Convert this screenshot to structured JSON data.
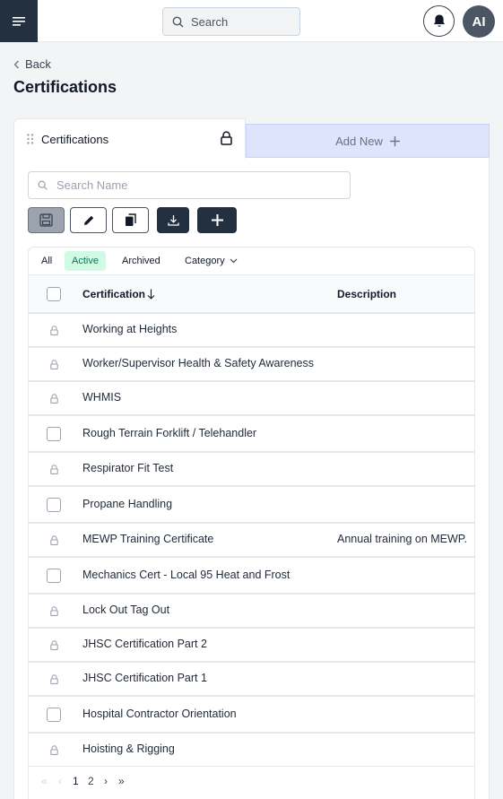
{
  "header": {
    "search_placeholder": "Search",
    "avatar_initials": "AI"
  },
  "nav": {
    "back_label": "Back",
    "page_title": "Certifications"
  },
  "tabs": {
    "active_label": "Certifications",
    "add_label": "Add New"
  },
  "search": {
    "placeholder": "Search Name"
  },
  "filters": {
    "all": "All",
    "active": "Active",
    "archived": "Archived",
    "category": "Category"
  },
  "table": {
    "col_certification": "Certification",
    "col_description": "Description",
    "rows": [
      {
        "name": "Working at Heights",
        "description": "",
        "locked": true
      },
      {
        "name": "Worker/Supervisor Health & Safety Awareness",
        "description": "",
        "locked": true
      },
      {
        "name": "WHMIS",
        "description": "",
        "locked": true
      },
      {
        "name": "Rough Terrain Forklift / Telehandler",
        "description": "",
        "locked": false
      },
      {
        "name": "Respirator Fit Test",
        "description": "",
        "locked": true
      },
      {
        "name": "Propane Handling",
        "description": "",
        "locked": false
      },
      {
        "name": "MEWP Training Certificate",
        "description": "Annual training on MEWP.",
        "locked": true
      },
      {
        "name": "Mechanics Cert - Local 95 Heat and Frost",
        "description": "",
        "locked": false
      },
      {
        "name": "Lock Out Tag Out",
        "description": "",
        "locked": true
      },
      {
        "name": "JHSC Certification Part 2",
        "description": "",
        "locked": true
      },
      {
        "name": "JHSC Certification Part 1",
        "description": "",
        "locked": true
      },
      {
        "name": "Hospital Contractor Orientation",
        "description": "",
        "locked": false
      },
      {
        "name": "Hoisting & Rigging",
        "description": "",
        "locked": true
      }
    ]
  },
  "pagination": {
    "first": "«",
    "prev": "‹",
    "page_1": "1",
    "page_2": "2",
    "next": "›",
    "last": "»"
  },
  "colors": {
    "dark": "#233040",
    "active_filter_bg": "#d1fae5",
    "active_filter_text": "#047857",
    "add_tab_bg": "#dde4fb"
  }
}
